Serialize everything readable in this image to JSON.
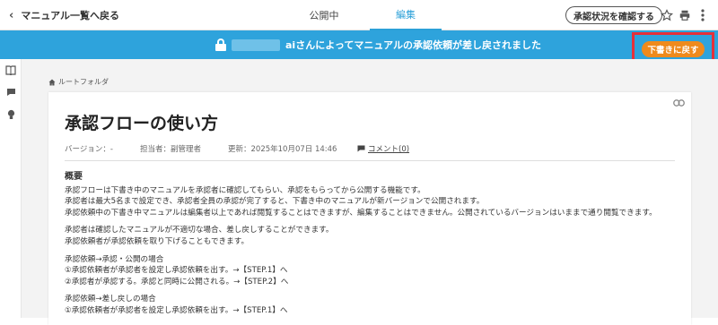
{
  "topbar": {
    "back_label": "マニュアル一覧へ戻る",
    "tabs": [
      {
        "label": "公開中",
        "active": false
      },
      {
        "label": "編集",
        "active": true
      }
    ],
    "confirm_button": "承認状況を確認する",
    "icons": [
      "star-icon",
      "print-icon",
      "more-icon"
    ]
  },
  "banner": {
    "message": "さんによってマニュアルの承認依頼が差し戻されました",
    "name_suffix": "ai",
    "revert_button": "下書きに戻す"
  },
  "breadcrumb": {
    "label": "ルートフォルダ"
  },
  "document": {
    "title": "承認フローの使い方",
    "version": "バージョン：-",
    "owner": "担当者：副管理者",
    "updated": "更新：2025年10月07日 14:46",
    "comment": "コメント(0)",
    "heading": "概要",
    "lines": [
      "承認フローは下書き中のマニュアルを承認者に確認してもらい、承認をもらってから公開する機能です。",
      "承認者は最大5名まで設定でき、承認者全員の承認が完了すると、下書き中のマニュアルが新バージョンで公開されます。",
      "承認依頼中の下書き中マニュアルは編集者以上であれば閲覧することはできますが、編集することはできません。公開されているバージョンはいままで通り閲覧できます。"
    ],
    "lines2": [
      "承認者は確認したマニュアルが不適切な場合、差し戻しすることができます。",
      "承認依頼者が承認依頼を取り下げることもできます。"
    ],
    "lines3": [
      "承認依頼→承認・公開の場合",
      "①承認依頼者が承認者を設定し承認依頼を出す。→【STEP.1】へ",
      "②承認者が承認する。承認と同時に公開される。→【STEP.2】へ"
    ],
    "lines4": [
      "承認依頼→差し戻しの場合",
      "①承認依頼者が承認者を設定し承認依頼を出す。→【STEP.1】へ"
    ]
  },
  "colors": {
    "banner": "#2ea3dc",
    "accent": "#2ba0d8",
    "revert_button": "#ef8a1c",
    "highlight_border": "#e5303a"
  }
}
